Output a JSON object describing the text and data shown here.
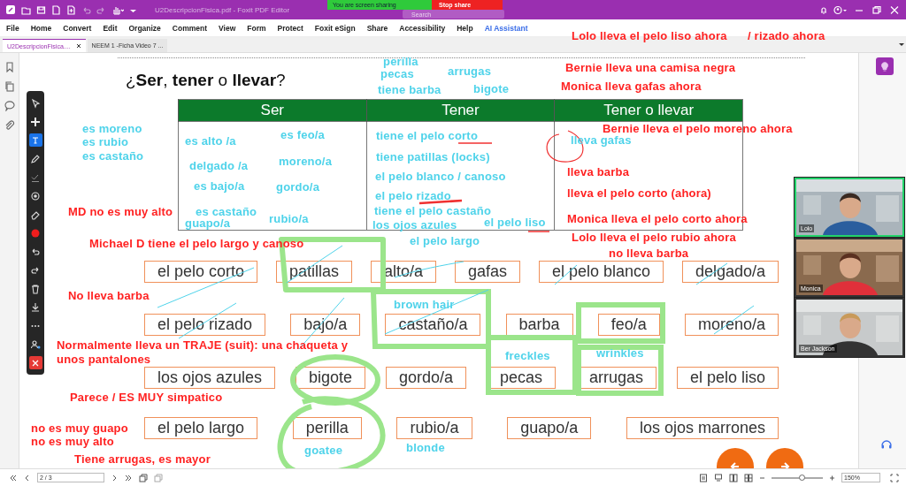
{
  "window": {
    "title": "U2DescripcionFisica.pdf - Foxit PDF Editor"
  },
  "search": {
    "placeholder": "Search"
  },
  "screen_share": {
    "message": "You are screen sharing",
    "stop_label": "Stop share"
  },
  "menu": [
    {
      "label": "File",
      "kind": "plain"
    },
    {
      "label": "Home",
      "kind": "plain"
    },
    {
      "label": "Convert",
      "kind": "plain"
    },
    {
      "label": "Edit",
      "kind": "plain"
    },
    {
      "label": "Organize",
      "kind": "plain"
    },
    {
      "label": "Comment",
      "kind": "plain"
    },
    {
      "label": "View",
      "kind": "plain"
    },
    {
      "label": "Form",
      "kind": "plain"
    },
    {
      "label": "Protect",
      "kind": "plain"
    },
    {
      "label": "Foxit eSign",
      "kind": "plain"
    },
    {
      "label": "Share",
      "kind": "plain"
    },
    {
      "label": "Accessibility",
      "kind": "plain"
    },
    {
      "label": "Help",
      "kind": "plain"
    },
    {
      "label": "AI Assistant",
      "kind": "ai"
    }
  ],
  "tabs": [
    {
      "label": "U2DescripcionFisica....",
      "selected": true
    },
    {
      "label": "NEEM 1 -Ficha Video  7 ...",
      "selected": false
    }
  ],
  "annotation_tools": [
    {
      "kind": "select",
      "selected": false
    },
    {
      "kind": "move",
      "selected": false
    },
    {
      "kind": "text",
      "selected": true
    },
    {
      "kind": "pencil",
      "selected": false
    },
    {
      "kind": "check",
      "selected": false
    },
    {
      "kind": "stamp",
      "selected": false
    },
    {
      "kind": "eraser",
      "selected": false
    },
    {
      "kind": "color",
      "selected": false
    },
    {
      "kind": "undo",
      "selected": false
    },
    {
      "kind": "redo",
      "selected": false
    },
    {
      "kind": "delete",
      "selected": false
    },
    {
      "kind": "save",
      "selected": false
    },
    {
      "kind": "more",
      "selected": false
    },
    {
      "kind": "user",
      "selected": false
    },
    {
      "kind": "close",
      "selected": false
    }
  ],
  "document": {
    "heading": "¿**Ser**, **tener** o **llevar**?",
    "table": {
      "columns": [
        "Ser",
        "Tener",
        "Tener o llevar"
      ]
    },
    "word_rows": [
      [
        "el pelo corto",
        "patillas",
        "alto/a",
        "gafas",
        "el pelo blanco",
        "delgado/a"
      ],
      [
        "el pelo rizado",
        "bajo/a",
        "castaño/a",
        "barba",
        "feo/a",
        "moreno/a"
      ],
      [
        "los ojos azules",
        "bigote",
        "gordo/a",
        "pecas",
        "arrugas",
        "el pelo liso"
      ],
      [
        "el pelo largo",
        "perilla",
        "rubio/a",
        "guapo/a",
        "los ojos marrones"
      ]
    ]
  },
  "annotations": [
    {
      "text": "Lolo lleva el pelo liso ahora",
      "color": "#ff2222"
    },
    {
      "text": "/ rizado ahora",
      "color": "#ff2222"
    },
    {
      "text": "perilla",
      "color": "#4fd3ea"
    },
    {
      "text": "pecas",
      "color": "#4fd3ea"
    },
    {
      "text": "arrugas",
      "color": "#4fd3ea"
    },
    {
      "text": "Bernie lleva una camisa negra",
      "color": "#ff2222"
    },
    {
      "text": "tiene barba",
      "color": "#4fd3ea"
    },
    {
      "text": "bigote",
      "color": "#4fd3ea"
    },
    {
      "text": "Monica lleva gafas ahora",
      "color": "#ff2222"
    },
    {
      "text": "es moreno",
      "color": "#4fd3ea"
    },
    {
      "text": "es feo/a",
      "color": "#4fd3ea"
    },
    {
      "text": "tiene el pelo corto",
      "color": "#4fd3ea"
    },
    {
      "text": "Bernie lleva el pelo moreno ahora",
      "color": "#ff2222"
    },
    {
      "text": "es rubio",
      "color": "#4fd3ea"
    },
    {
      "text": "es alto /a",
      "color": "#4fd3ea"
    },
    {
      "text": "lleva gafas",
      "color": "#4fd3ea"
    },
    {
      "text": "es castaño",
      "color": "#4fd3ea"
    },
    {
      "text": "delgado /a",
      "color": "#4fd3ea"
    },
    {
      "text": "moreno/a",
      "color": "#4fd3ea"
    },
    {
      "text": "tiene patillas (locks)",
      "color": "#4fd3ea"
    },
    {
      "text": "el pelo blanco / canoso",
      "color": "#4fd3ea"
    },
    {
      "text": "lleva barba",
      "color": "#ff2222"
    },
    {
      "text": "es bajo/a",
      "color": "#4fd3ea"
    },
    {
      "text": "gordo/a",
      "color": "#4fd3ea"
    },
    {
      "text": "el pelo rizado",
      "color": "#4fd3ea"
    },
    {
      "text": "lleva el pelo corto (ahora)",
      "color": "#ff2222"
    },
    {
      "text": "MD no es muy alto",
      "color": "#ff2222"
    },
    {
      "text": "es castaño",
      "color": "#4fd3ea"
    },
    {
      "text": "guapo/a",
      "color": "#4fd3ea"
    },
    {
      "text": "rubio/a",
      "color": "#4fd3ea"
    },
    {
      "text": "tiene el pelo castaño",
      "color": "#4fd3ea"
    },
    {
      "text": "los ojos azules",
      "color": "#4fd3ea"
    },
    {
      "text": "el pelo liso",
      "color": "#4fd3ea"
    },
    {
      "text": "Monica lleva el pelo corto ahora",
      "color": "#ff2222"
    },
    {
      "text": "Michael D tiene el pelo largo y canoso",
      "color": "#ff2222"
    },
    {
      "text": "el pelo largo",
      "color": "#4fd3ea"
    },
    {
      "text": "Lolo lleva el pelo rubio ahora",
      "color": "#ff2222"
    },
    {
      "text": "no lleva barba",
      "color": "#ff2222"
    },
    {
      "text": "No lleva barba",
      "color": "#ff2222"
    },
    {
      "text": "brown hair",
      "color": "#4fd3ea"
    },
    {
      "text": "Normalmente lleva un TRAJE (suit): una chaqueta y",
      "color": "#ff2222"
    },
    {
      "text": "unos pantalones",
      "color": "#ff2222"
    },
    {
      "text": "freckles",
      "color": "#4fd3ea"
    },
    {
      "text": "wrinkles",
      "color": "#4fd3ea"
    },
    {
      "text": "Parece / ES MUY simpatico",
      "color": "#ff2222"
    },
    {
      "text": "no es muy guapo",
      "color": "#ff2222"
    },
    {
      "text": "no es muy alto",
      "color": "#ff2222"
    },
    {
      "text": "Tiene arrugas, es mayor",
      "color": "#ff2222"
    },
    {
      "text": "goatee",
      "color": "#4fd3ea"
    },
    {
      "text": "blonde",
      "color": "#4fd3ea"
    }
  ],
  "participants": [
    {
      "name": "Lolo",
      "speaking": true
    },
    {
      "name": "Monica",
      "speaking": false
    },
    {
      "name": "Ber Jackson",
      "speaking": false
    }
  ],
  "status_bar": {
    "page": "2 / 3",
    "zoom": "150%",
    "zoom_slider": {
      "level": 0.58
    }
  }
}
